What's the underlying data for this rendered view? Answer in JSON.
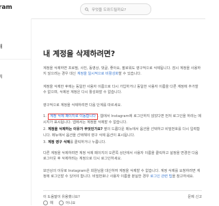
{
  "header": {
    "logo_text": "ram",
    "search_placeholder": "무엇을 도와드릴까요?"
  },
  "left_nav": {
    "back_label": "개",
    "item_label": "리"
  },
  "main": {
    "title": "내 계정을 삭제하려면?",
    "intro": "계정을 삭제하면 프로필, 사진, 동영상, 댓글, 좋아요, 팔로워도 영구적으로 삭제됩니다. 잠시 계정을 사용하지 않으려는 경우 대신 ",
    "intro_link": "계정을 일시적으로 비활성화",
    "intro_tail": "할 수 있습니다.",
    "para2": "계정을 삭제한 후에는 동일한 사용자 이름으로 다시 가입하거나 동일한 사용자 이름을 다른 계정에 추가할 수 없으며, 삭제된 계정은 다시 활성화할 수 없습니다.",
    "para3": "영구적으로 계정을 삭제하려면 다음 단계를 따르세요.",
    "step1_highlight": "계정 삭제 페이지로 이동합니다",
    "step1_rest": ". 웹에서 Instagram에 로그인하지 않았다면 먼저 로그인을 하라는 메시지가 표시됩니다. 앱에서는 계정을 삭제할 수 없습니다.",
    "step2_bold": "계정을 삭제하는 이유가 무엇인가요?",
    "step2_rest": " 옆의 드롭다운 메뉴에서 옵션을 선택하고 비밀번호를 다시 입력합니다. 메뉴에서 옵션을 선택해야 영구 삭제 옵션이 표시됩니다.",
    "step3_bold": "계정 영구 삭제",
    "step3_rest": "를 클릭하거나 누릅니다.",
    "para4": "다른 계정을 삭제하려면 계정 삭제 페이지의 오른쪽 상단에서 사용자 이름을 클릭하고 설정을 변경한 다음 로그아웃 후 삭제하려는 계정으로 다시 로그인하세요.",
    "para5": "보안상의 이유로 Instagram은 회원님을 대신하여 계정을 삭제할 수 없습니다. 계정 삭제를 요청하려면 계정에 로그인할 수 있어야 합니다. 비밀번호나 사용자 이름을 분실한 경우 ",
    "para5_link": "로그인 관련 팁",
    "para5_tail": "을 참고하세요.",
    "footer_question": "이 도움말이 유용했나요?",
    "footer_yes": "예",
    "footer_no": "아니요",
    "footer_report": "문제 신고"
  }
}
